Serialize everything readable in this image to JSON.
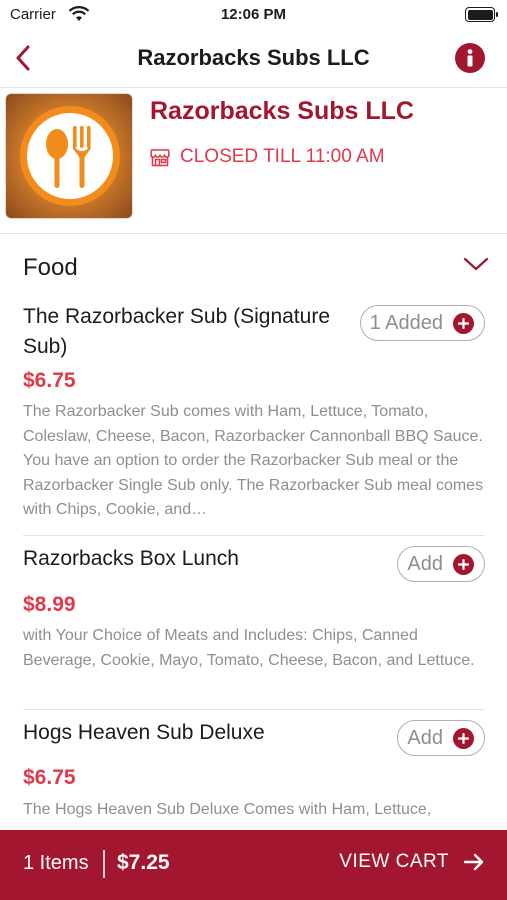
{
  "status_bar": {
    "carrier": "Carrier",
    "time": "12:06 PM"
  },
  "nav": {
    "title": "Razorbacks Subs LLC",
    "back_icon": "chevron-left-icon",
    "info_icon": "info-icon"
  },
  "restaurant": {
    "name": "Razorbacks Subs LLC",
    "status": "CLOSED TILL 11:00 AM",
    "logo": "fork-spoon-logo"
  },
  "menu": {
    "category": "Food",
    "items": [
      {
        "name": "The Razorbacker Sub (Signature Sub)",
        "price": "$6.75",
        "description": "The Razorbacker Sub comes with Ham, Lettuce, Tomato, Coleslaw, Cheese, Bacon, Razorbacker Cannonball BBQ Sauce. You have an option to order the Razorbacker Sub meal or the Razorbacker Single Sub only. The Razorbacker Sub meal comes with Chips, Cookie, and…",
        "button": "1 Added"
      },
      {
        "name": "Razorbacks Box Lunch",
        "price": "$8.99",
        "description": "with Your Choice of Meats and Includes: Chips, Canned Beverage, Cookie, Mayo, Tomato, Cheese, Bacon, and Lettuce.",
        "button": "Add"
      },
      {
        "name": "Hogs Heaven Sub Deluxe",
        "price": "$6.75",
        "description": "The Hogs Heaven Sub Deluxe Comes with Ham, Lettuce,",
        "button": "Add"
      }
    ]
  },
  "cart": {
    "count": "1 Items",
    "total": "$7.25",
    "view_label": "VIEW CART"
  },
  "colors": {
    "brand": "#a3162f",
    "price": "#e0394a",
    "muted": "#8e8e93"
  }
}
